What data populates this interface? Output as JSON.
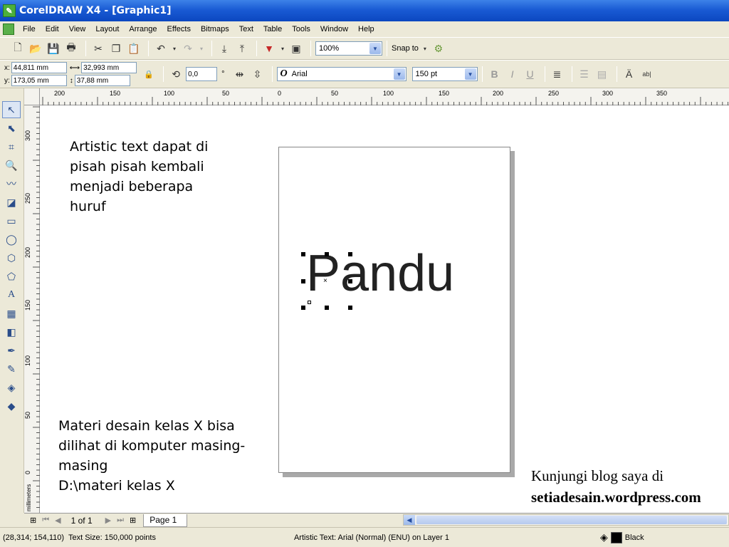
{
  "window": {
    "title": "CorelDRAW X4 - [Graphic1]"
  },
  "menu": {
    "items": [
      "File",
      "Edit",
      "View",
      "Layout",
      "Arrange",
      "Effects",
      "Bitmaps",
      "Text",
      "Table",
      "Tools",
      "Window",
      "Help"
    ]
  },
  "standard_toolbar": {
    "zoom": "100%",
    "snap_to": "Snap to"
  },
  "property_bar": {
    "x_label": "x:",
    "x_value": "44,811 mm",
    "y_label": "y:",
    "y_value": "173,05 mm",
    "width_value": "32,993 mm",
    "height_value": "37,88 mm",
    "rotation_value": "0,0",
    "degree_symbol": "°",
    "font_name": "Arial",
    "font_size": "150 pt"
  },
  "ruler": {
    "h_ticks": [
      "200",
      "150",
      "100",
      "50",
      "0",
      "50",
      "100",
      "150",
      "200",
      "250",
      "300",
      "350"
    ],
    "v_ticks": [
      "300",
      "250",
      "200",
      "150",
      "100",
      "50",
      "0"
    ],
    "v_unit": "millimeters"
  },
  "canvas": {
    "artistic_text": "Pandu",
    "note_top": [
      "Artistic text dapat di",
      "pisah pisah kembali",
      "menjadi beberapa",
      "huruf"
    ],
    "note_bottom": [
      "Materi desain kelas X bisa",
      "dilihat di komputer masing-",
      "masing",
      "D:\\materi kelas X"
    ],
    "blog_line1": "Kunjungi blog saya di",
    "blog_line2": "setiadesain.wordpress.com"
  },
  "page_nav": {
    "counter": "1 of 1",
    "tab": "Page 1"
  },
  "status": {
    "coords": "(28,314; 154,110)",
    "text_size": "Text Size: 150,000 points",
    "object_info": "Artistic Text: Arial (Normal) (ENU) on Layer 1",
    "fill_color_name": "Black",
    "fill_color": "#000000"
  },
  "colors": {
    "title_bar": "#1a5bd4",
    "chrome": "#ece9d8"
  }
}
